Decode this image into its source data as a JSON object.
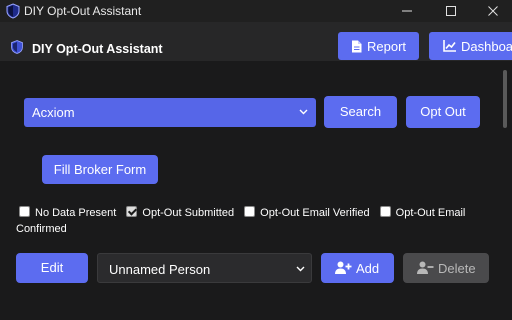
{
  "window": {
    "title": "DIY Opt-Out Assistant"
  },
  "header": {
    "title": "DIY Opt-Out Assistant",
    "report_label": "Report",
    "dashboard_label": "Dashboard"
  },
  "broker": {
    "selected": "Acxiom"
  },
  "actions": {
    "search_label": "Search",
    "optout_label": "Opt Out",
    "fill_form_label": "Fill Broker Form"
  },
  "statuses": [
    {
      "label": "No Data Present",
      "checked": false
    },
    {
      "label": "Opt-Out Submitted",
      "checked": true
    },
    {
      "label": "Opt-Out Email Verified",
      "checked": false
    },
    {
      "label": "Opt-Out Email Confirmed",
      "checked": false
    }
  ],
  "person": {
    "edit_label": "Edit",
    "selected": "Unnamed Person",
    "add_label": "Add",
    "delete_label": "Delete"
  },
  "colors": {
    "accent": "#5c6cf0",
    "disabled": "#4a4a4c",
    "background": "#1a1a1b"
  },
  "icons": [
    "shield-icon",
    "minimize-icon",
    "maximize-icon",
    "close-icon",
    "report-icon",
    "chart-icon",
    "chevron-down-icon",
    "user-add-icon",
    "user-remove-icon"
  ]
}
